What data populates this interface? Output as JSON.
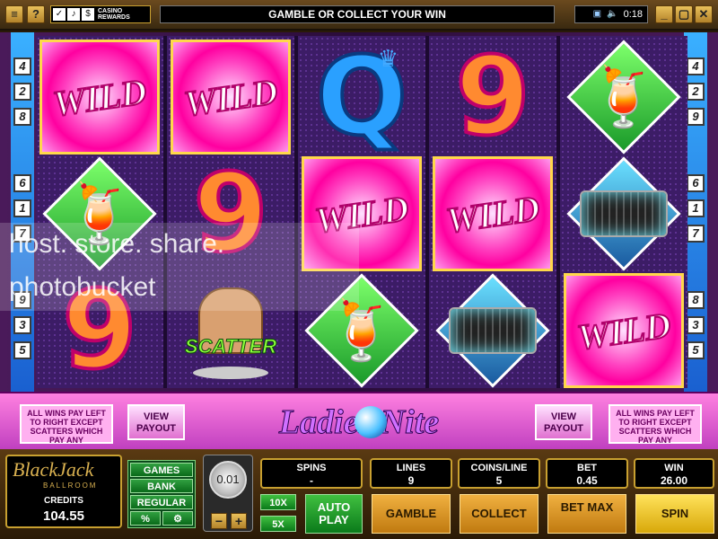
{
  "topbar": {
    "help_btn": "?",
    "casino_rewards": "CASINO\nREWARDS",
    "message": "GAMBLE OR COLLECT YOUR WIN",
    "clock": "0:18",
    "menu_btn": "≡",
    "minimize": "_",
    "maximize": "▢",
    "close": "✕"
  },
  "paylines": {
    "left": [
      "4",
      "2",
      "8",
      "6",
      "1",
      "7",
      "9",
      "3",
      "5"
    ],
    "right": [
      "4",
      "2",
      "9",
      "6",
      "1",
      "7",
      "8",
      "3",
      "5"
    ]
  },
  "reels": [
    [
      "WILD",
      "cocktail",
      "9"
    ],
    [
      "WILD",
      "9",
      "SCATTER"
    ],
    [
      "Q",
      "WILD",
      "cocktail"
    ],
    [
      "9",
      "WILD",
      "purse"
    ],
    [
      "cocktail",
      "purse",
      "WILD"
    ]
  ],
  "banner": {
    "info_left": "ALL WINS PAY LEFT TO RIGHT EXCEPT SCATTERS WHICH PAY ANY",
    "info_right": "ALL WINS PAY LEFT TO RIGHT EXCEPT SCATTERS WHICH PAY ANY",
    "view_payout_left": "VIEW PAYOUT",
    "view_payout_right": "VIEW PAYOUT",
    "logo_text": "Ladies Nite"
  },
  "symbols": {
    "wild": "WILD",
    "scatter": "SCATTER",
    "nine": "9",
    "queen": "Q"
  },
  "panel": {
    "brand_name": "BlackJack",
    "brand_sub": "BALLROOM",
    "credits_label": "CREDITS",
    "credits_value": "104.55",
    "games": "GAMES",
    "bank": "BANK",
    "regular": "REGULAR",
    "percent": "%",
    "settings": "⚙",
    "coin_value": "0.01",
    "minus": "−",
    "plus": "+",
    "x10": "10X",
    "x5": "5X",
    "autoplay": "AUTO PLAY",
    "gamble": "GAMBLE",
    "collect": "COLLECT",
    "betmax": "BET MAX",
    "spin": "SPIN"
  },
  "stats": [
    {
      "label": "SPINS",
      "value": "-"
    },
    {
      "label": "LINES",
      "value": "9"
    },
    {
      "label": "COINS/LINE",
      "value": "5"
    },
    {
      "label": "BET",
      "value": "0.45"
    },
    {
      "label": "WIN",
      "value": "26.00"
    }
  ],
  "watermark": {
    "line1": "host. store. share.",
    "line2": "photobucket"
  }
}
